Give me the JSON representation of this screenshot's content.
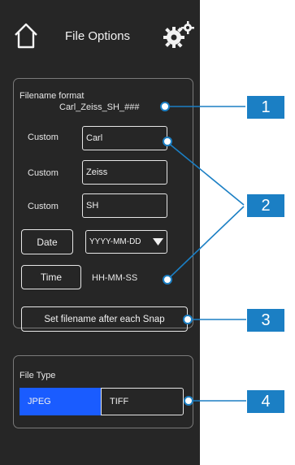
{
  "header": {
    "title": "File Options",
    "home_icon": "home-icon",
    "settings_icon": "gears-icon"
  },
  "filename": {
    "heading": "Filename format",
    "preview": "Carl_Zeiss_SH_###",
    "rows": [
      {
        "label": "Custom",
        "value": "Carl"
      },
      {
        "label": "Custom",
        "value": "Zeiss"
      },
      {
        "label": "Custom",
        "value": "SH"
      }
    ],
    "date_button": "Date",
    "date_format": "YYYY-MM-DD",
    "time_button": "Time",
    "time_format": "HH-MM-SS",
    "snap_button": "Set filename after each Snap"
  },
  "file_type": {
    "heading": "File Type",
    "options": [
      "JPEG",
      "TIFF"
    ],
    "selected": "JPEG"
  },
  "callouts": [
    "1",
    "2",
    "3",
    "4"
  ],
  "colors": {
    "panel": "#262626",
    "accent": "#1a5cff",
    "callout": "#1b7fc4"
  }
}
